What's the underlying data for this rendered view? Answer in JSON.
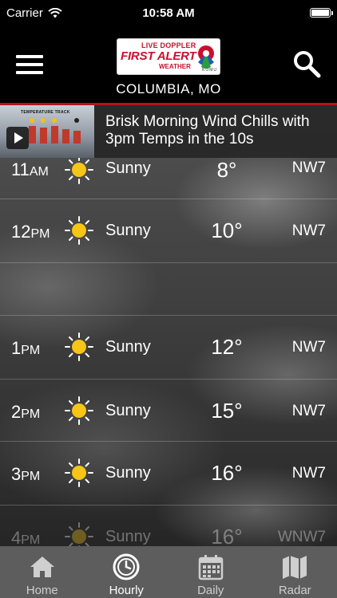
{
  "status_bar": {
    "carrier": "Carrier",
    "time": "10:58 AM"
  },
  "header": {
    "logo": {
      "line1": "LIVE DOPPLER",
      "line2": "FIRST ALERT",
      "line3": "WEATHER",
      "line4": "KOMU"
    },
    "location": "COLUMBIA, MO"
  },
  "banner": {
    "headline": "Brisk Morning Wind Chills with 3pm Temps in the 10s",
    "thumb_title": "TEMPERATURE TRACK"
  },
  "hours": [
    {
      "hour": "11",
      "ampm": "AM",
      "condition": "Sunny",
      "temp": "8°",
      "wind": "NW7"
    },
    {
      "hour": "12",
      "ampm": "PM",
      "condition": "Sunny",
      "temp": "10°",
      "wind": "NW7"
    },
    {
      "hour": "1",
      "ampm": "PM",
      "condition": "Sunny",
      "temp": "12°",
      "wind": "NW7"
    },
    {
      "hour": "2",
      "ampm": "PM",
      "condition": "Sunny",
      "temp": "15°",
      "wind": "NW7"
    },
    {
      "hour": "3",
      "ampm": "PM",
      "condition": "Sunny",
      "temp": "16°",
      "wind": "NW7"
    },
    {
      "hour": "4",
      "ampm": "PM",
      "condition": "Sunny",
      "temp": "16°",
      "wind": "WNW7"
    }
  ],
  "tabs": [
    {
      "label": "Home",
      "icon": "home-icon",
      "active": false
    },
    {
      "label": "Hourly",
      "icon": "clock-icon",
      "active": true
    },
    {
      "label": "Daily",
      "icon": "calendar-icon",
      "active": false
    },
    {
      "label": "Radar",
      "icon": "map-icon",
      "active": false
    }
  ],
  "colors": {
    "accent": "#b4141e",
    "sun": "#f5c518",
    "tab_bar": "#5d5d5d"
  }
}
